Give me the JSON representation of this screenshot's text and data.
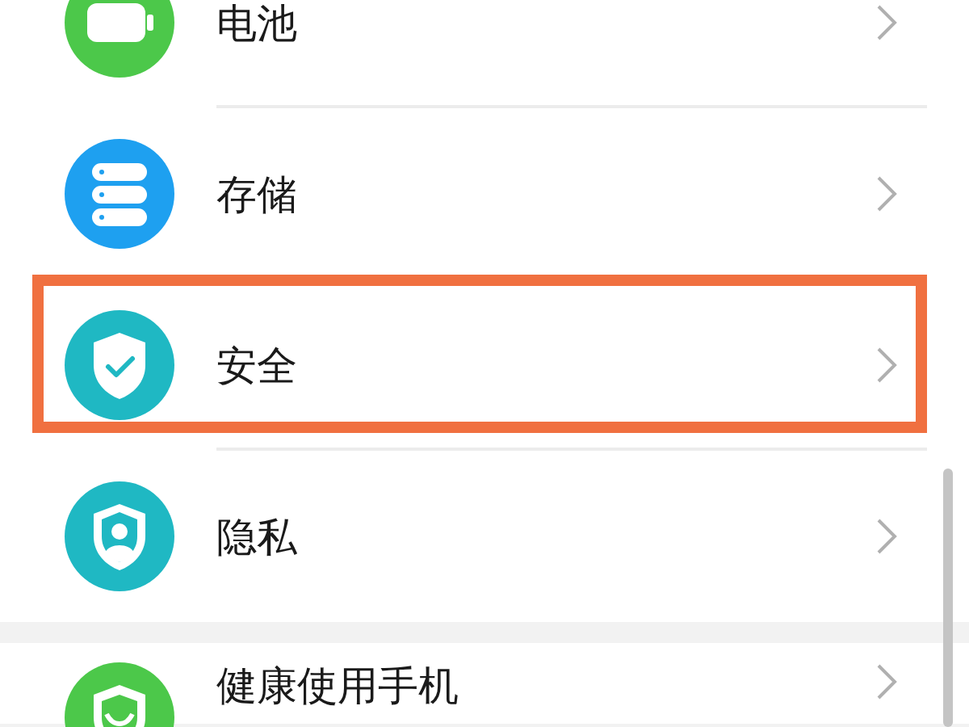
{
  "groups": [
    {
      "items": [
        {
          "label": "电池",
          "color": "#4cc84a",
          "highlighted": false
        },
        {
          "label": "存储",
          "color": "#1ea0f0",
          "highlighted": false
        },
        {
          "label": "安全",
          "color": "#1fb8c3",
          "highlighted": true
        },
        {
          "label": "隐私",
          "color": "#1fb8c3",
          "highlighted": false
        }
      ]
    },
    {
      "items": [
        {
          "label": "健康使用手机",
          "color": "#4cc84a",
          "highlighted": false
        }
      ]
    }
  ]
}
